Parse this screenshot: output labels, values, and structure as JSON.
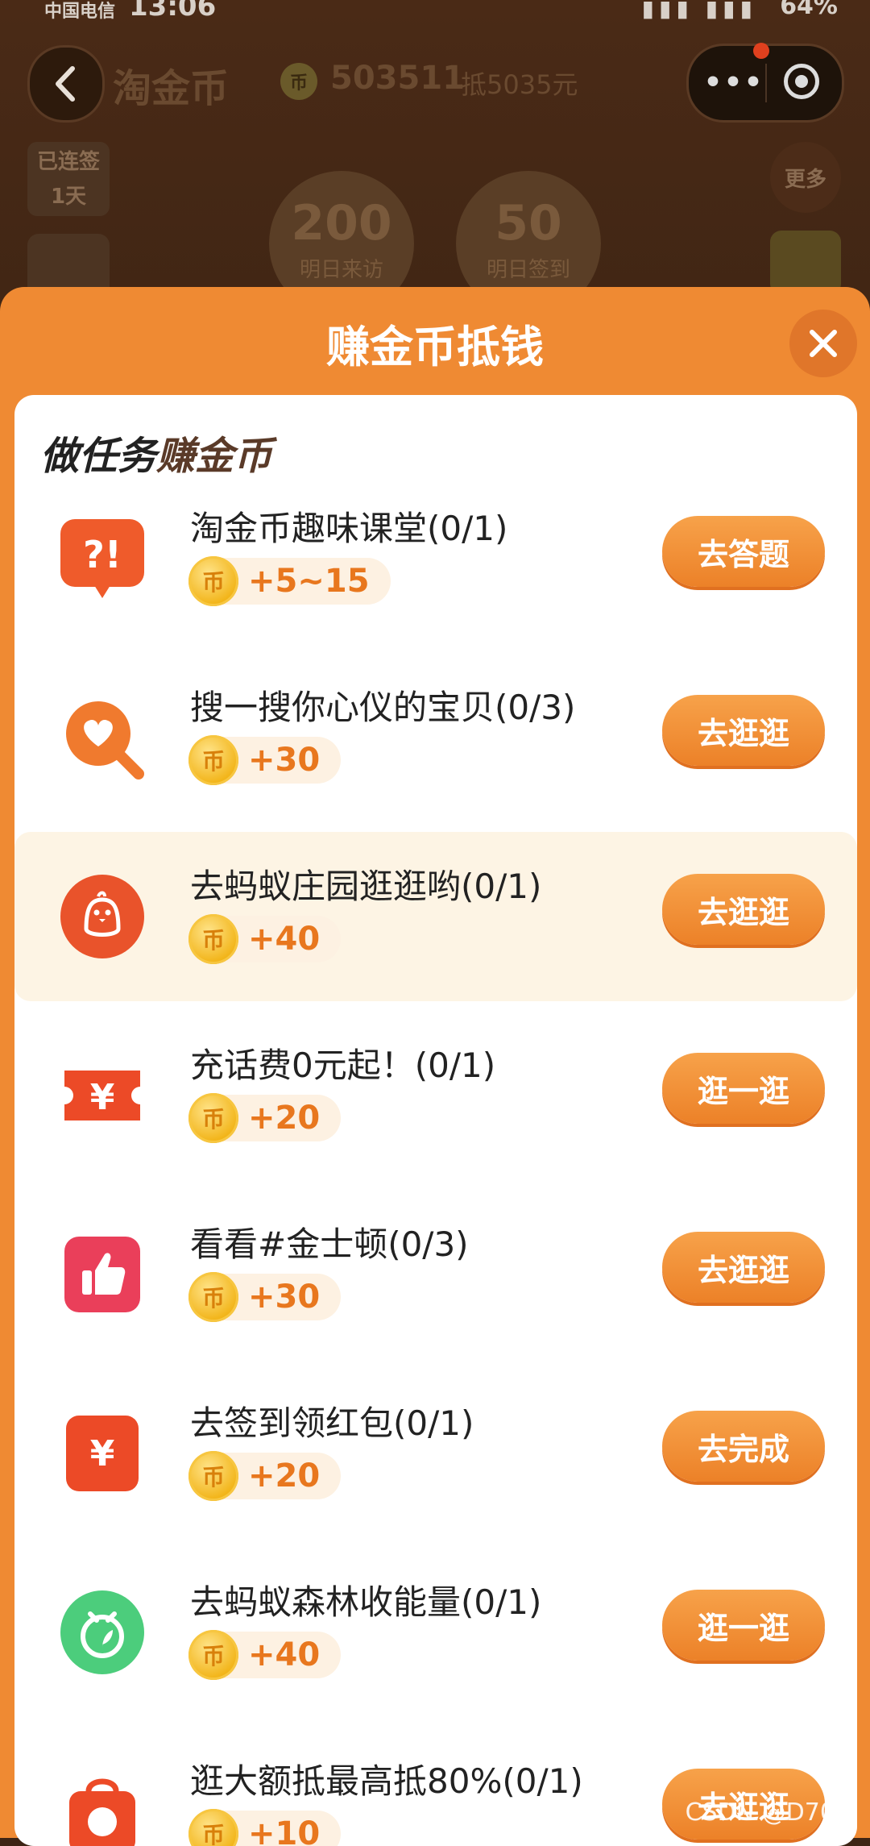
{
  "status_bar": {
    "carrier": "中国电信",
    "time": "13:06",
    "battery": "64%"
  },
  "header": {
    "brand": "淘金币",
    "balance": "503511",
    "deduct": "抵5035元",
    "streak_label": "已连签",
    "streak_days": "1天",
    "more_label": "更多",
    "coin_symbol": "币"
  },
  "bonuses": [
    {
      "amount": "200",
      "label": "明日来访"
    },
    {
      "amount": "50",
      "label": "明日签到"
    }
  ],
  "sheet": {
    "title": "赚金币抵钱",
    "section_title_a": "做任务",
    "section_title_b": "赚金币",
    "tasks": [
      {
        "name": "淘金币趣味课堂(0/1)",
        "reward": "+5~15",
        "action": "去答题",
        "icon": "quiz-icon",
        "color": "#ef5b2b"
      },
      {
        "name": "搜一搜你心仪的宝贝(0/3)",
        "reward": "+30",
        "action": "去逛逛",
        "icon": "search-heart-icon",
        "color": "#f07a2e"
      },
      {
        "name": "去蚂蚁庄园逛逛哟(0/1)",
        "reward": "+40",
        "action": "去逛逛",
        "icon": "chick-icon",
        "color": "#e9532b"
      },
      {
        "name": "充话费0元起！(0/1)",
        "reward": "+20",
        "action": "逛一逛",
        "icon": "yuan-ticket-icon",
        "color": "#ec4a27"
      },
      {
        "name": "看看#金士顿(0/3)",
        "reward": "+30",
        "action": "去逛逛",
        "icon": "thumbs-up-icon",
        "color": "#ea3f5a"
      },
      {
        "name": "去签到领红包(0/1)",
        "reward": "+20",
        "action": "去完成",
        "icon": "red-packet-icon",
        "color": "#ec4a27"
      },
      {
        "name": "去蚂蚁森林收能量(0/1)",
        "reward": "+40",
        "action": "逛一逛",
        "icon": "sprout-icon",
        "color": "#4ccd7c"
      },
      {
        "name": "逛大额抵最高抵80%(0/1)",
        "reward": "+10",
        "action": "去逛逛",
        "icon": "shopping-bag-icon",
        "color": "#ec4a27"
      }
    ]
  },
  "watermark": "CSDN @D709"
}
